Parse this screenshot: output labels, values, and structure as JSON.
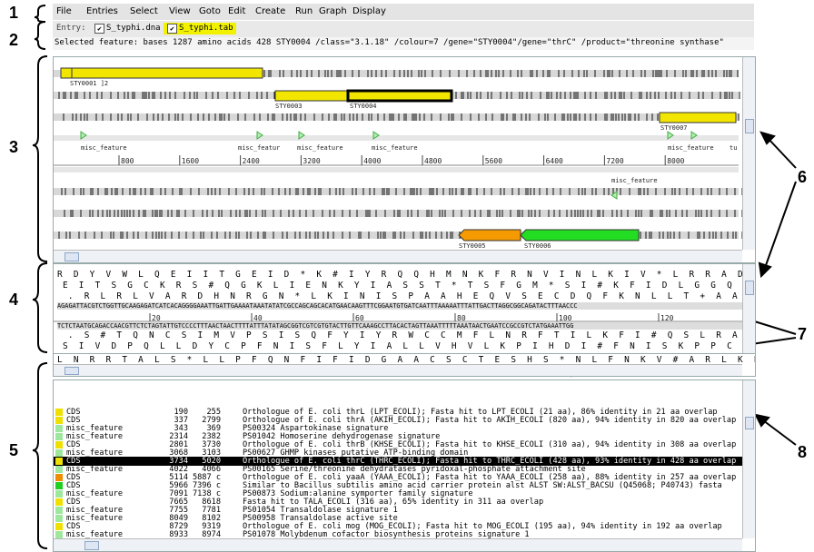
{
  "callouts": {
    "c1": "1",
    "c2": "2",
    "c3": "3",
    "c4": "4",
    "c5": "5",
    "c6": "6",
    "c7": "7",
    "c8": "8"
  },
  "menu": [
    "File",
    "Entries",
    "Select",
    "View",
    "Goto",
    "Edit",
    "Create",
    "Run",
    "Graph",
    "Display"
  ],
  "entry": {
    "label": "Entry:",
    "dna": "S_typhi.dna",
    "tab": "S_typhi.tab"
  },
  "selected": "Selected feature:  bases 1287  amino acids 428  STY0004  /class=\"3.1.18\" /colour=7 /gene=\"STY0004\"/gene=\"thrC\" /product=\"threonine synthase\"",
  "overview": {
    "gene_labels": {
      "sty0001": "STY0001 ]2",
      "sty0003": "STY0003",
      "sty0004": "STY0004",
      "sty0007": "STY0007",
      "sty0005": "STY0005",
      "sty0006": "STY0006"
    },
    "misc": {
      "m1": "misc_feature",
      "m2": "misc_featur",
      "m3": "misc_feature",
      "m4": "misc_feature",
      "m5": "misc_feature",
      "m6": "tu",
      "m7": "misc_feature"
    },
    "ruler": [
      "800",
      "1600",
      "2400",
      "3200",
      "4000",
      "4800",
      "5600",
      "6400",
      "7200",
      "8000"
    ]
  },
  "sequence": {
    "f1": "R  D  Y  V  W  L  Q  E  I  I  T  G  E  I  D  *  K  #  I  Y  R  Q  Q  H  M  N  K  F  R  N  V  I  N  L  K  I  V  *  L  R  R  A  D  T  L  T",
    "f2": " E  I  T  S  G  C  K  R  S  #  Q  G  K  L  I  E  N  K  Y  I  A  S  S  T  *  T  S  F  G  M  *  S  I  #  K  F  I  D  L  G  G  Q  I  L  #  P",
    "f3": "  .  R  L  R  L  V  A  R  D  H  N  R  G  N  *  L  K  I  N  I  S  P  A  A  H  E  Q  V  S  E  C  D  Q  F  K  N  L  L  T  +  A  A  R  Y  F  N",
    "fwd": "AGAGATTACGTCTGGTTGCAAGAGATCATCACAGGGGAAATTGATTGAAAATAAATATATCGCCAGCAGCACATGAACAAGTTTCGGAATGTGATCAATTTAAAAATTTATTGACTTAGGCGGCAGATACTTTAACCC",
    "rev": "TCTCTAATGCAGACCAACGTTCTCTAGTATTGTCCCCTTTAACTAACTTTTATTTATATAGCGGTCGTCGTGTACTTGTTCAAAGCCTTACACTAGTTAAATTTTTAAATAACTGAATCCGCCGTCTATGAAATTGG",
    "ruler": [
      "20",
      "40",
      "60",
      "80",
      "100",
      "120"
    ],
    "r1": "  .  S  #  T  Q  N  C  S  I  M  V  P  S  I  S  Q  F  Y  I  Y  R  W  C  C  M  F  L  N  R  F  T  I  L  K  F  I  #  Q  S  L  R  A  S  V  K  V",
    "r2": " S  I  V  D  P  Q  L  L  D  Y  C  P  F  N  I  S  F  L  Y  I  A  L  L  V  H  V  L  K  P  I  H  D  I  #  F  N  I  S  K  P  P  C  I  S  #  K",
    "r3": "L  N  R  R  T  A  L  S  *  L  L  P  F  Q  N  F  I  F  I  D  G  A  A  C  S  C  T  E  S  H  S  *  N  L  F  N  K  V  #  A  R  L  K  L  W"
  },
  "features": [
    {
      "key": "CDS",
      "start": "190",
      "end": "255",
      "note": "Orthologue of E. coli thrL (LPT_ECOLI); Fasta hit to LPT_ECOLI (21 aa), 86% identity in 21 aa overlap",
      "color": "#f0e000"
    },
    {
      "key": "CDS",
      "start": "337",
      "end": "2799",
      "note": "Orthologue of E. coli thrA (AKIH_ECOLI); Fasta hit to AKIH_ECOLI (820 aa), 94% identity in 820 aa overlap",
      "color": "#f0e000"
    },
    {
      "key": "misc_feature",
      "start": "343",
      "end": "369",
      "note": "PS00324 Aspartokinase signature",
      "color": "#9ee89e"
    },
    {
      "key": "misc_feature",
      "start": "2314",
      "end": "2382",
      "note": "PS01042 Homoserine dehydrogenase signature",
      "color": "#9ee89e"
    },
    {
      "key": "CDS",
      "start": "2801",
      "end": "3730",
      "note": "Orthologue of E. coli thrB (KHSE_ECOLI); Fasta hit to KHSE_ECOLI (310 aa), 94% identity in 308 aa overlap",
      "color": "#f0e000"
    },
    {
      "key": "misc_feature",
      "start": "3068",
      "end": "3103",
      "note": "PS00627 GHMP kinases putative ATP-binding domain",
      "color": "#9ee89e"
    },
    {
      "key": "CDS",
      "start": "3734",
      "end": "5020",
      "note": "Orthologue of E. coli thrC (THRC_ECOLI); Fasta hit to THRC_ECOLI (428 aa), 93% identity in 428 aa overlap",
      "color": "#f0e000",
      "selected": true
    },
    {
      "key": "misc_feature",
      "start": "4022",
      "end": "4066",
      "note": "PS00165 Serine/threonine dehydratases pyridoxal-phosphate attachment site",
      "color": "#9ee89e"
    },
    {
      "key": "CDS",
      "start": "5114",
      "end": "5887 c",
      "note": "Orthologue of E. coli yaaA (YAAA_ECOLI); Fasta hit to YAAA_ECOLI (258 aa), 88% identity in 257 aa overlap",
      "color": "#f08c00"
    },
    {
      "key": "CDS",
      "start": "5966",
      "end": "7396 c",
      "note": "Similar to Bacillus subtilis amino acid carrier protein alst ALST SW:ALST_BACSU (Q45068; P40743) fasta",
      "color": "#20d020"
    },
    {
      "key": "misc_feature",
      "start": "7091",
      "end": "7138 c",
      "note": "PS00873 Sodium:alanine symporter family signature",
      "color": "#9ee89e"
    },
    {
      "key": "CDS",
      "start": "7665",
      "end": "8618",
      "note": "Fasta hit to TALA_ECOLI (316 aa), 65% identity in 311 aa overlap",
      "color": "#f0e000"
    },
    {
      "key": "misc_feature",
      "start": "7755",
      "end": "7781",
      "note": "PS01054 Transaldolase signature 1",
      "color": "#9ee89e"
    },
    {
      "key": "misc_feature",
      "start": "8049",
      "end": "8102",
      "note": "PS00958 Transaldolase active site",
      "color": "#9ee89e"
    },
    {
      "key": "CDS",
      "start": "8729",
      "end": "9319",
      "note": "Orthologue of E. coli mog (MOG_ECOLI); Fasta hit to MOG_ECOLI (195 aa), 94% identity in 192 aa overlap",
      "color": "#f0e000"
    },
    {
      "key": "misc_feature",
      "start": "8933",
      "end": "8974",
      "note": "PS01078 Molybdenum cofactor biosynthesis proteins signature 1",
      "color": "#9ee89e"
    }
  ]
}
